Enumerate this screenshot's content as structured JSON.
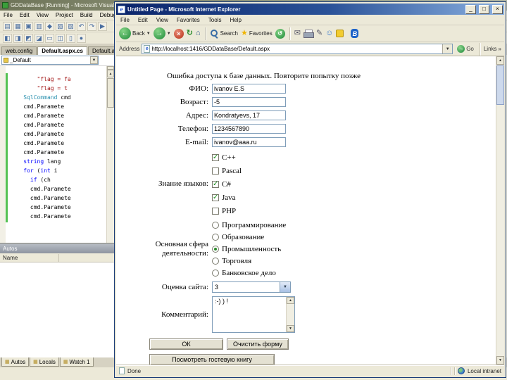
{
  "vs": {
    "title": "GDDataBase [Running] - Microsoft Visual Studio",
    "menu": [
      "File",
      "Edit",
      "View",
      "Project",
      "Build",
      "Debug"
    ],
    "toolbar_row1": [
      {
        "name": "new-file",
        "glyph": "▤"
      },
      {
        "name": "open-file",
        "glyph": "▦"
      },
      {
        "name": "save",
        "glyph": "▣"
      },
      {
        "name": "save-all",
        "glyph": "▥"
      },
      {
        "name": "cut",
        "glyph": "◆"
      },
      {
        "name": "copy",
        "glyph": "▧"
      },
      {
        "name": "paste",
        "glyph": "▨"
      },
      {
        "name": "undo",
        "glyph": "↶"
      },
      {
        "name": "redo",
        "glyph": "↷"
      },
      {
        "name": "start-debug",
        "glyph": "▶"
      }
    ],
    "toolbar_row2": [
      {
        "name": "solution-explorer",
        "glyph": "◧"
      },
      {
        "name": "properties-window",
        "glyph": "◨"
      },
      {
        "name": "toolbox",
        "glyph": "◩"
      },
      {
        "name": "error-list",
        "glyph": "◪"
      },
      {
        "name": "output-window",
        "glyph": "▭"
      },
      {
        "name": "find",
        "glyph": "◫"
      },
      {
        "name": "comment-lines",
        "glyph": "▯"
      },
      {
        "name": "breakpoint",
        "glyph": "●"
      }
    ],
    "tabs": [
      {
        "label": "web.config"
      },
      {
        "label": "Default.aspx.cs"
      },
      {
        "label": "Default.aspx"
      }
    ],
    "nav_dropdown": "_Default",
    "scroll_up": "▲",
    "scroll_down": "▼",
    "code_lines": [
      [
        {
          "t": "        \"flag = fa",
          "c": "#a31515"
        }
      ],
      [
        {
          "t": "        \"flag = t",
          "c": "#a31515"
        }
      ],
      [
        {
          "t": "    ",
          "c": "#000000"
        },
        {
          "t": "SqlCommand",
          "c": "#2b91af"
        },
        {
          "t": " cmd",
          "c": "#000000"
        }
      ],
      [
        {
          "t": "    cmd.Paramete",
          "c": "#000000"
        }
      ],
      [
        {
          "t": "    cmd.Paramete",
          "c": "#000000"
        }
      ],
      [
        {
          "t": "    cmd.Paramete",
          "c": "#000000"
        }
      ],
      [
        {
          "t": "    cmd.Paramete",
          "c": "#000000"
        }
      ],
      [
        {
          "t": "    cmd.Paramete",
          "c": "#000000"
        }
      ],
      [
        {
          "t": "    cmd.Paramete",
          "c": "#000000"
        }
      ],
      [
        {
          "t": "    ",
          "c": "#000000"
        },
        {
          "t": "string",
          "c": "#0000ff"
        },
        {
          "t": " lang",
          "c": "#000000"
        }
      ],
      [
        {
          "t": "    ",
          "c": "#000000"
        },
        {
          "t": "for",
          "c": "#0000ff"
        },
        {
          "t": " (",
          "c": "#000000"
        },
        {
          "t": "int",
          "c": "#0000ff"
        },
        {
          "t": " i",
          "c": "#000000"
        }
      ],
      [
        {
          "t": "      ",
          "c": "#000000"
        },
        {
          "t": "if",
          "c": "#0000ff"
        },
        {
          "t": " (ch",
          "c": "#000000"
        }
      ],
      [
        {
          "t": "      cmd.Paramete",
          "c": "#000000"
        }
      ],
      [
        {
          "t": "      cmd.Paramete",
          "c": "#000000"
        }
      ],
      [
        {
          "t": "      cmd.Paramete",
          "c": "#000000"
        }
      ],
      [
        {
          "t": "      cmd.Paramete",
          "c": "#000000"
        }
      ]
    ],
    "autos": {
      "title": "Autos",
      "name_column": "Name"
    },
    "bottom_tabs": [
      {
        "label": "Autos",
        "icon": "▦"
      },
      {
        "label": "Locals",
        "icon": "▦"
      },
      {
        "label": "Watch 1",
        "icon": "▦"
      }
    ]
  },
  "ie": {
    "title": "Untitled Page - Microsoft Internet Explorer",
    "window_buttons": {
      "minimize": "_",
      "maximize": "□",
      "close": "×"
    },
    "menu": [
      "File",
      "Edit",
      "View",
      "Favorites",
      "Tools",
      "Help"
    ],
    "toolbar": {
      "back_label": "Back",
      "back_glyph": "←",
      "forward_glyph": "→",
      "stop_glyph": "×",
      "refresh_glyph": "↻",
      "home_glyph": "⌂",
      "search_label": "Search",
      "favorites_label": "Favorites",
      "favorites_glyph": "★",
      "history_glyph": "↺",
      "mail_glyph": "✉",
      "edit_glyph": "✎",
      "messenger_glyph": "☺",
      "bluetooth_glyph": "B"
    },
    "address": {
      "label": "Address",
      "doc_glyph": "e",
      "url": "http://localhost:1416/GDDataBase/Default.aspx",
      "go_glyph": "→",
      "go_label": "Go",
      "links_label": "Links",
      "links_chevron": "»"
    },
    "form": {
      "error_text": "Ошибка доступа к базе данных. Повторите попытку позже",
      "fio_label": "ФИО:",
      "fio_value": "ivanov E.S",
      "age_label": "Возраст:",
      "age_value": "-5",
      "address_label": "Адрес:",
      "address_value": "Kondratyevs, 17",
      "phone_label": "Телефон:",
      "phone_value": "1234567890",
      "email_label": "E-mail:",
      "email_value": "ivanov@aaa.ru",
      "languages_label": "Знание языков:",
      "languages": [
        {
          "label": "C++",
          "checked": true
        },
        {
          "label": "Pascal",
          "checked": false
        },
        {
          "label": "C#",
          "checked": true
        },
        {
          "label": "Java",
          "checked": true
        },
        {
          "label": "PHP",
          "checked": false
        }
      ],
      "sphere_label": "Основная сфера деятельности:",
      "spheres": [
        {
          "label": "Программирование",
          "selected": false
        },
        {
          "label": "Образование",
          "selected": false
        },
        {
          "label": "Промышленность",
          "selected": true
        },
        {
          "label": "Торговля",
          "selected": false
        },
        {
          "label": "Банковское дело",
          "selected": false
        }
      ],
      "rating_label": "Оценка сайта:",
      "rating_value": "3",
      "comment_label": "Комментарий:",
      "comment_value": ":-) ) !",
      "ok_button": "ОК",
      "clear_button": "Очистить форму",
      "guestbook_button": "Посмотреть гостевую книгу"
    },
    "status": {
      "done": "Done",
      "zone": "Local intranet"
    }
  }
}
